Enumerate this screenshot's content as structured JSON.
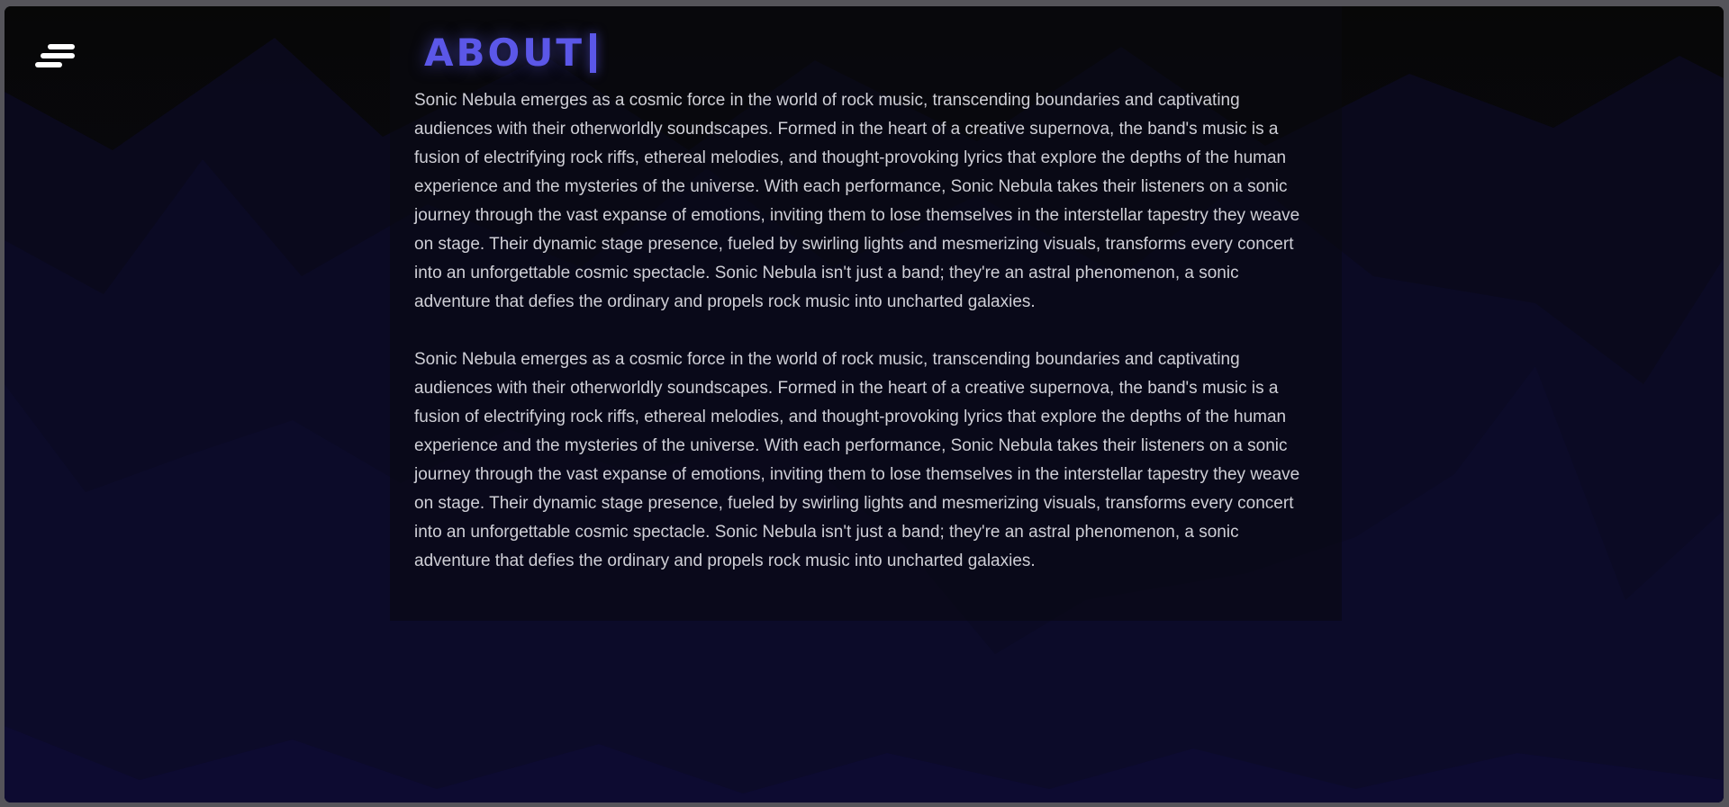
{
  "menu": {
    "icon": "menu-icon"
  },
  "about": {
    "heading": "ABOUT",
    "paragraphs": [
      "Sonic Nebula emerges as a cosmic force in the world of rock music, transcending boundaries and captivating audiences with their otherworldly soundscapes. Formed in the heart of a creative supernova, the band's music is a fusion of electrifying rock riffs, ethereal melodies, and thought-provoking lyrics that explore the depths of the human experience and the mysteries of the universe. With each performance, Sonic Nebula takes their listeners on a sonic journey through the vast expanse of emotions, inviting them to lose themselves in the interstellar tapestry they weave on stage. Their dynamic stage presence, fueled by swirling lights and mesmerizing visuals, transforms every concert into an unforgettable cosmic spectacle. Sonic Nebula isn't just a band; they're an astral phenomenon, a sonic adventure that defies the ordinary and propels rock music into uncharted galaxies.",
      "Sonic Nebula emerges as a cosmic force in the world of rock music, transcending boundaries and captivating audiences with their otherworldly soundscapes. Formed in the heart of a creative supernova, the band's music is a fusion of electrifying rock riffs, ethereal melodies, and thought-provoking lyrics that explore the depths of the human experience and the mysteries of the universe. With each performance, Sonic Nebula takes their listeners on a sonic journey through the vast expanse of emotions, inviting them to lose themselves in the interstellar tapestry they weave on stage. Their dynamic stage presence, fueled by swirling lights and mesmerizing visuals, transforms every concert into an unforgettable cosmic spectacle. Sonic Nebula isn't just a band; they're an astral phenomenon, a sonic adventure that defies the ordinary and propels rock music into uncharted galaxies."
    ]
  },
  "colors": {
    "accent": "#5b57e8",
    "background": "#0a0a14",
    "wave": "#0e0c2e",
    "text": "#cfcfd6"
  }
}
